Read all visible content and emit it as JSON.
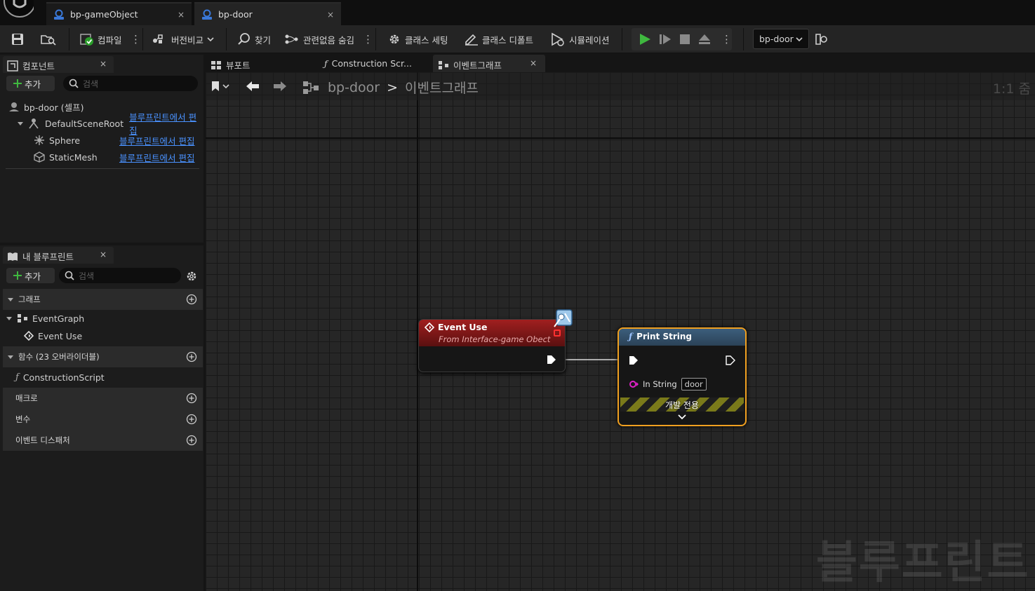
{
  "tabs": [
    {
      "label": "bp-gameObject",
      "close": "×"
    },
    {
      "label": "bp-door",
      "close": "×"
    }
  ],
  "toolbar": {
    "compile": "컴파일",
    "diff": "버전비교",
    "find": "찾기",
    "hide_unrelated": "관련없음 숨김",
    "class_settings": "클래스 세팅",
    "class_defaults": "클래스 디폴트",
    "simulation": "시뮬레이션",
    "debug_object": "bp-door"
  },
  "components": {
    "tab": "컴포넌트",
    "close": "×",
    "add": "추가",
    "search_placeholder": "검색",
    "self": "bp-door (셀프)",
    "items": [
      {
        "name": "DefaultSceneRoot",
        "link": "블루프린트에서 편집"
      },
      {
        "name": "Sphere",
        "link": "블루프린트에서 편집"
      },
      {
        "name": "StaticMesh",
        "link": "블루프린트에서 편집"
      }
    ]
  },
  "my_blueprint": {
    "tab": "내 블루프린트",
    "close": "×",
    "add": "추가",
    "search_placeholder": "검색",
    "graphs_label": "그래프",
    "event_graph": "EventGraph",
    "event_use": "Event Use",
    "functions_label": "함수 (23 오버라이더블)",
    "construction_script": "ConstructionScript",
    "macros_label": "매크로",
    "variables_label": "변수",
    "dispatchers_label": "이벤트 디스패처"
  },
  "editor_tabs": {
    "viewport": "뷰포트",
    "construction": "Construction Scr...",
    "event_graph": "이벤트그래프",
    "close": "×"
  },
  "graph": {
    "breadcrumb_root": "bp-door",
    "breadcrumb_sep": ">",
    "breadcrumb_current": "이벤트그래프",
    "zoom": "1:1 줌",
    "watermark": "블루프린트",
    "event_node": {
      "title": "Event Use",
      "subtitle": "From Interface-game Obect"
    },
    "print_node": {
      "title": "Print String",
      "pin_label": "In String",
      "pin_value": "door",
      "dev_only": "개발 전용"
    }
  },
  "colors": {
    "event_header": "#8c1a1a",
    "function_header": "#3c5e7c",
    "selection": "#f0a020",
    "link": "#4a92ff",
    "play": "#3fb83f",
    "string_pin": "#e020c8"
  }
}
